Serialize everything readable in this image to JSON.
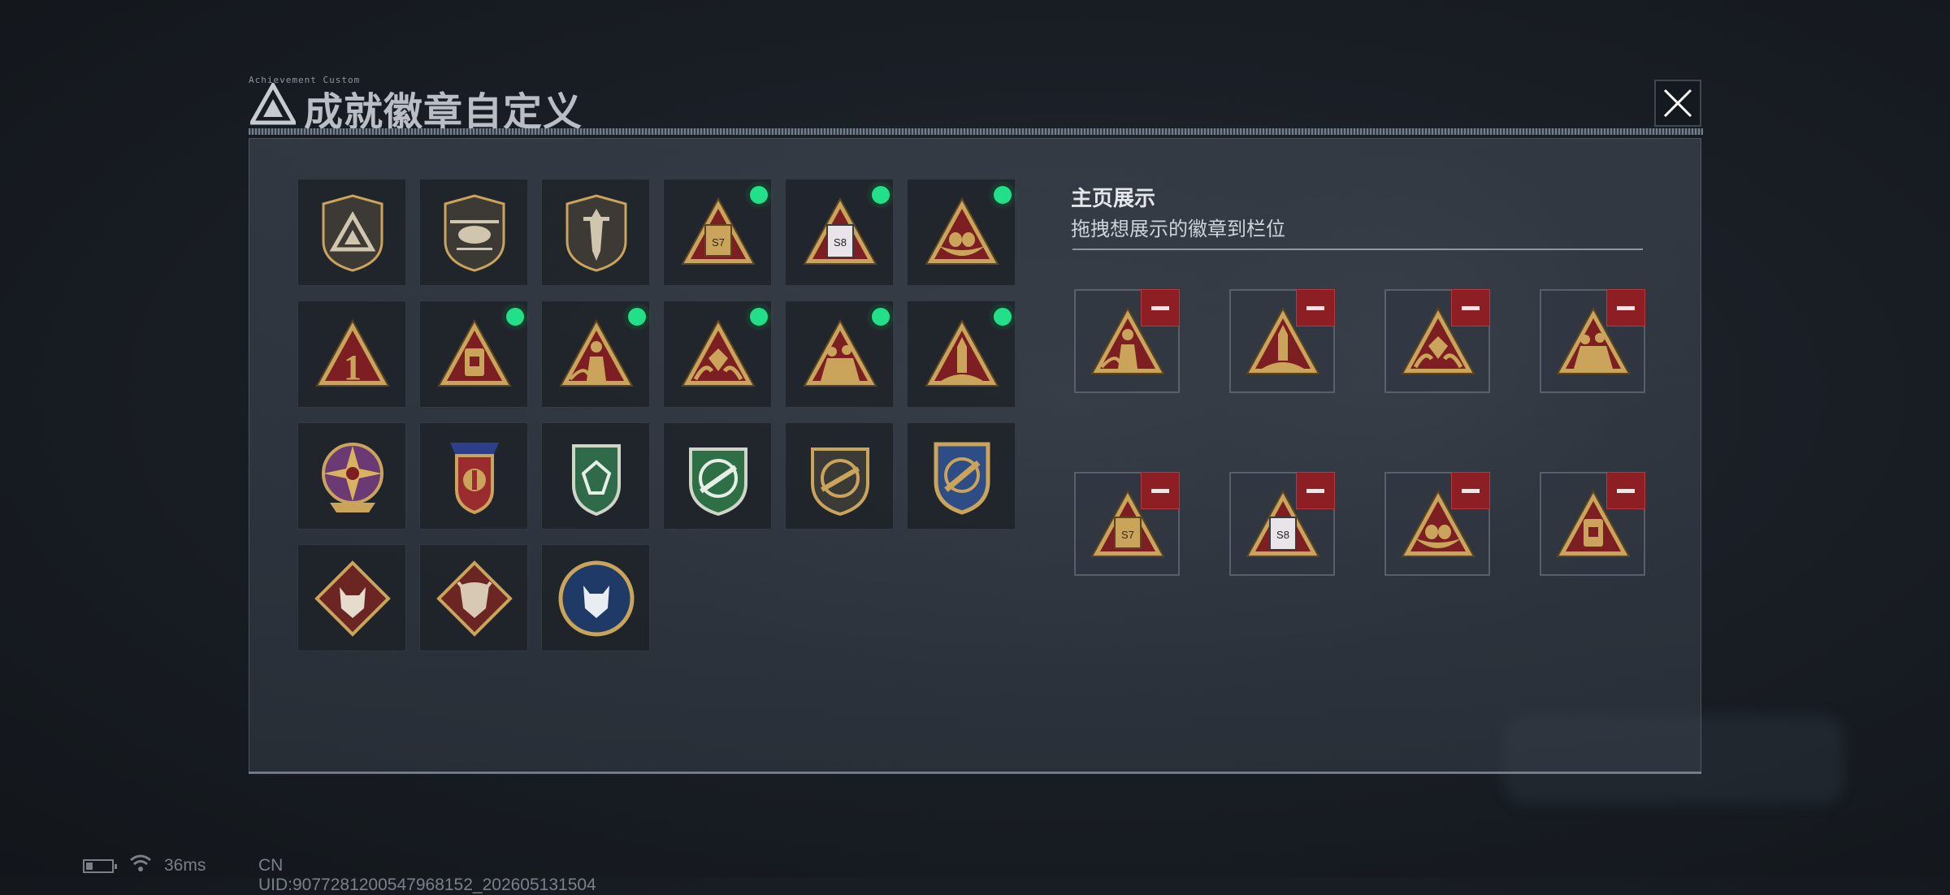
{
  "header": {
    "title": "成就徽章自定义",
    "tiny_label": "Achievement Custom"
  },
  "colors": {
    "accent_gold": "#c9a45a",
    "badge_red": "#7d1f22",
    "new_dot_green": "#22e08a",
    "remove_red": "#8d1f24"
  },
  "badge_grid": {
    "rows": [
      [
        {
          "icon": "delta-shield-badge-icon",
          "new": false
        },
        {
          "icon": "helicopter-shield-badge-icon",
          "new": false
        },
        {
          "icon": "dagger-shield-badge-icon",
          "new": false
        },
        {
          "icon": "s7-crate-triangle-badge-icon",
          "new": true
        },
        {
          "icon": "s8-crate-triangle-badge-icon",
          "new": true
        },
        {
          "icon": "eggs-triangle-badge-icon",
          "new": true
        }
      ],
      [
        {
          "icon": "number-one-triangle-badge-icon",
          "new": false
        },
        {
          "icon": "canister-triangle-badge-icon",
          "new": true
        },
        {
          "icon": "soldier-triangle-badge-icon",
          "new": true
        },
        {
          "icon": "gem-hands-triangle-badge-icon",
          "new": true
        },
        {
          "icon": "squad-triangle-badge-icon",
          "new": true
        },
        {
          "icon": "rocket-triangle-badge-icon",
          "new": true
        }
      ],
      [
        {
          "icon": "compass-star-medal-icon",
          "new": false
        },
        {
          "icon": "winged-shield-medal-icon",
          "new": false
        },
        {
          "icon": "green-gem-shield-medal-icon",
          "new": false
        },
        {
          "icon": "green-rifle-crest-icon",
          "new": false
        },
        {
          "icon": "rifle-round-shield-icon",
          "new": false
        },
        {
          "icon": "blue-missile-crest-icon",
          "new": false
        }
      ],
      [
        {
          "icon": "wolf-diamond-badge-icon",
          "new": false
        },
        {
          "icon": "dragon-diamond-badge-icon",
          "new": false
        },
        {
          "icon": "wolf-round-badge-icon",
          "new": false
        }
      ]
    ]
  },
  "showcase": {
    "heading": "主页展示",
    "subheading": "拖拽想展示的徽章到栏位",
    "slots": [
      {
        "icon": "soldier-triangle-badge-icon"
      },
      {
        "icon": "rocket-triangle-badge-icon"
      },
      {
        "icon": "gem-hands-triangle-badge-icon"
      },
      {
        "icon": "squad-triangle-badge-icon"
      },
      {
        "icon": "s7-crate-triangle-badge-icon"
      },
      {
        "icon": "s8-crate-triangle-badge-icon"
      },
      {
        "icon": "eggs-triangle-badge-icon"
      },
      {
        "icon": "canister-triangle-badge-icon"
      }
    ]
  },
  "status_bar": {
    "ping": "36ms",
    "uid": "CN UID:9077281200547968152_202605131504"
  }
}
